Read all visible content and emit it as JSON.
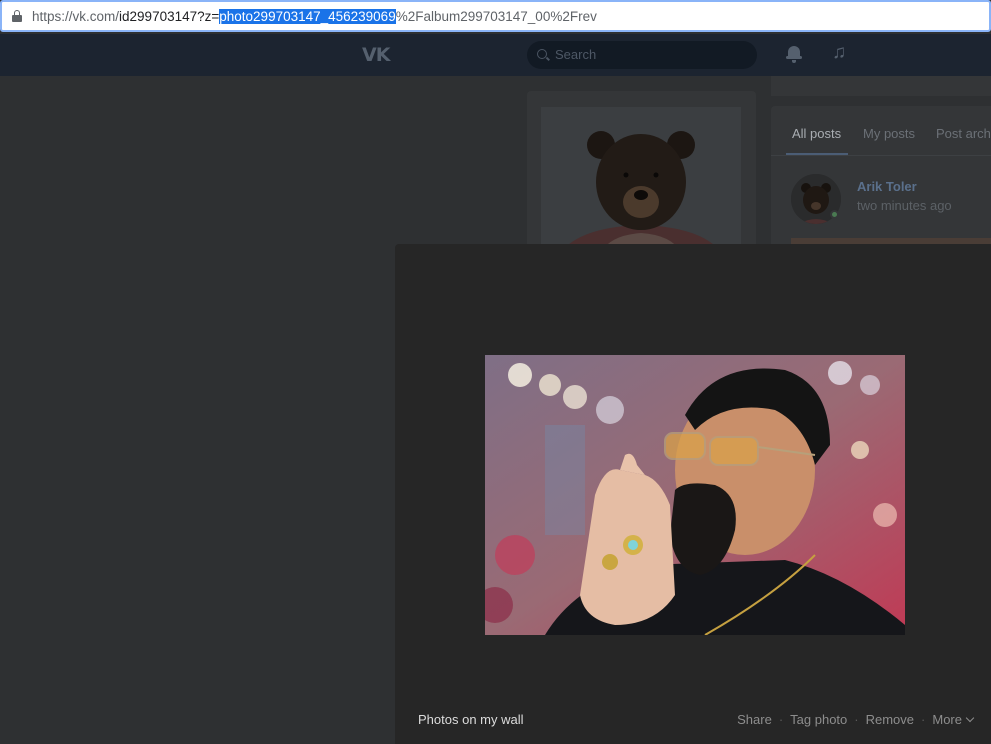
{
  "browser": {
    "url_prefix": "https://vk.com/",
    "url_id": "id299703147?z=",
    "url_selected": "photo299703147_456239069",
    "url_suffix": "%2Falbum299703147_00%2Frev"
  },
  "header": {
    "logo": "VK",
    "search_placeholder": "Search"
  },
  "feed": {
    "tabs": [
      "All posts",
      "My posts",
      "Post arch"
    ],
    "post_author": "Arik Toler",
    "post_time": "two minutes ago"
  },
  "viewer": {
    "album_title": "Photos on my wall",
    "actions": {
      "share": "Share",
      "tag": "Tag photo",
      "remove": "Remove",
      "more": "More"
    }
  },
  "colors": {
    "accent_selection": "#1a73e8",
    "vk_header": "#1c2430",
    "viewer_bg": "#262626"
  }
}
